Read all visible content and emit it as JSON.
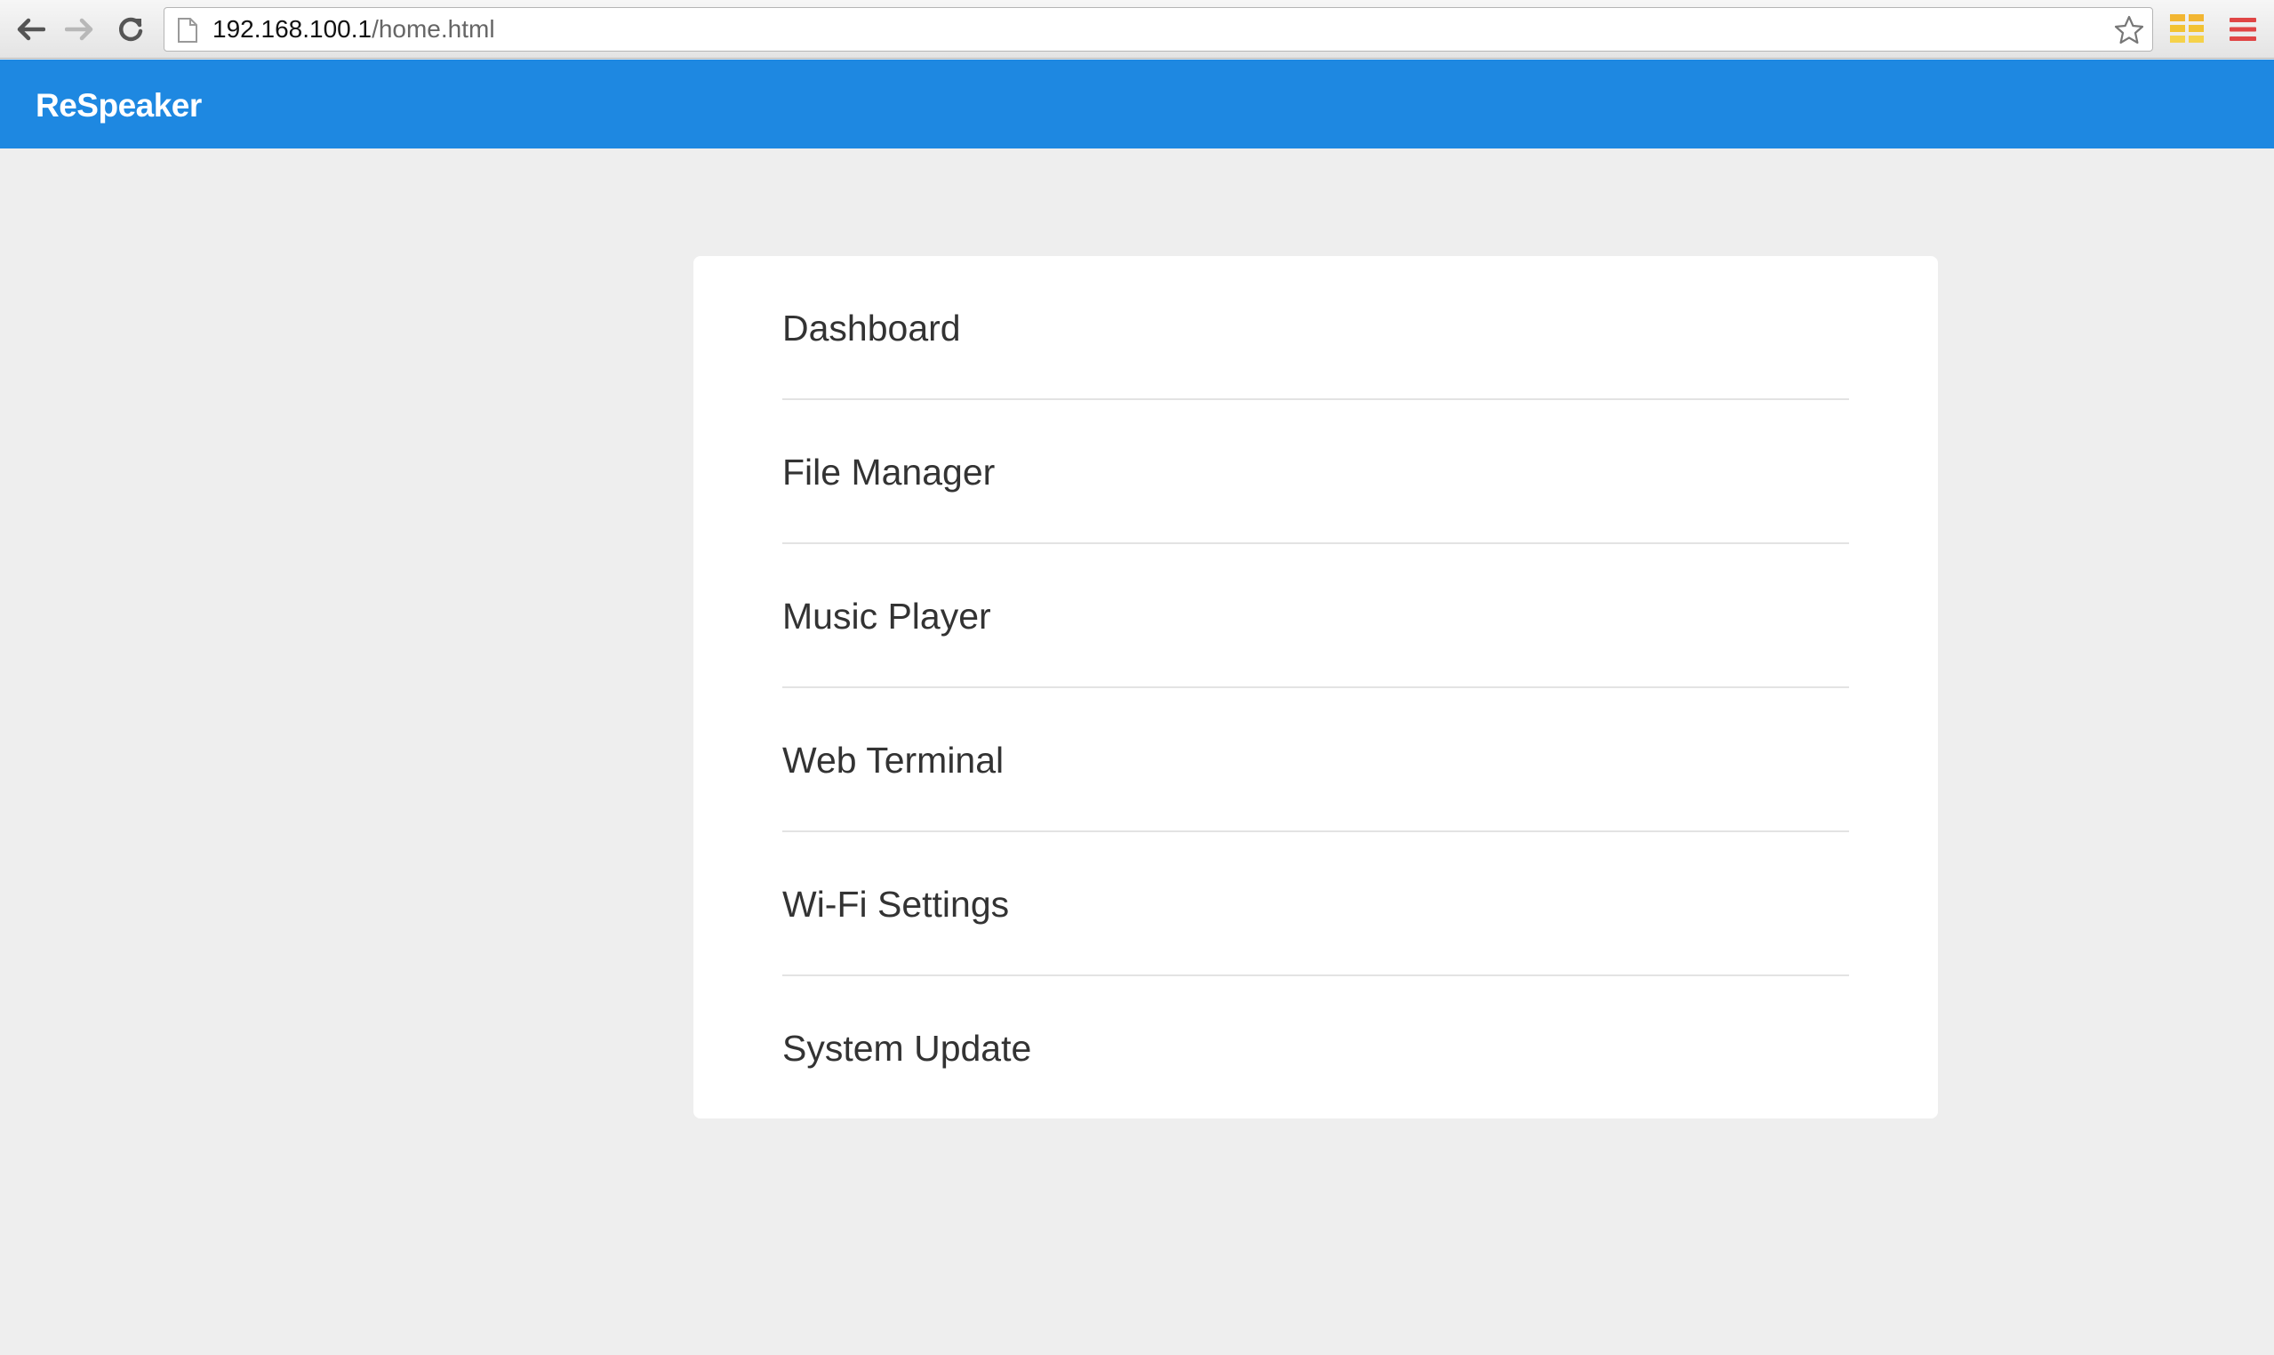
{
  "browser": {
    "url_host": "192.168.100.1",
    "url_path": "/home.html",
    "icons": {
      "back": "back-arrow-icon",
      "forward": "forward-arrow-icon",
      "reload": "reload-icon",
      "page": "page-icon",
      "bookmark": "star-icon",
      "extension": "extension-grid-icon",
      "menu": "hamburger-menu-icon"
    }
  },
  "header": {
    "brand": "ReSpeaker",
    "background_color": "#1e88e1"
  },
  "menu": {
    "items": [
      {
        "label": "Dashboard"
      },
      {
        "label": "File Manager"
      },
      {
        "label": "Music Player"
      },
      {
        "label": "Web Terminal"
      },
      {
        "label": "Wi-Fi Settings"
      },
      {
        "label": "System Update"
      }
    ]
  }
}
